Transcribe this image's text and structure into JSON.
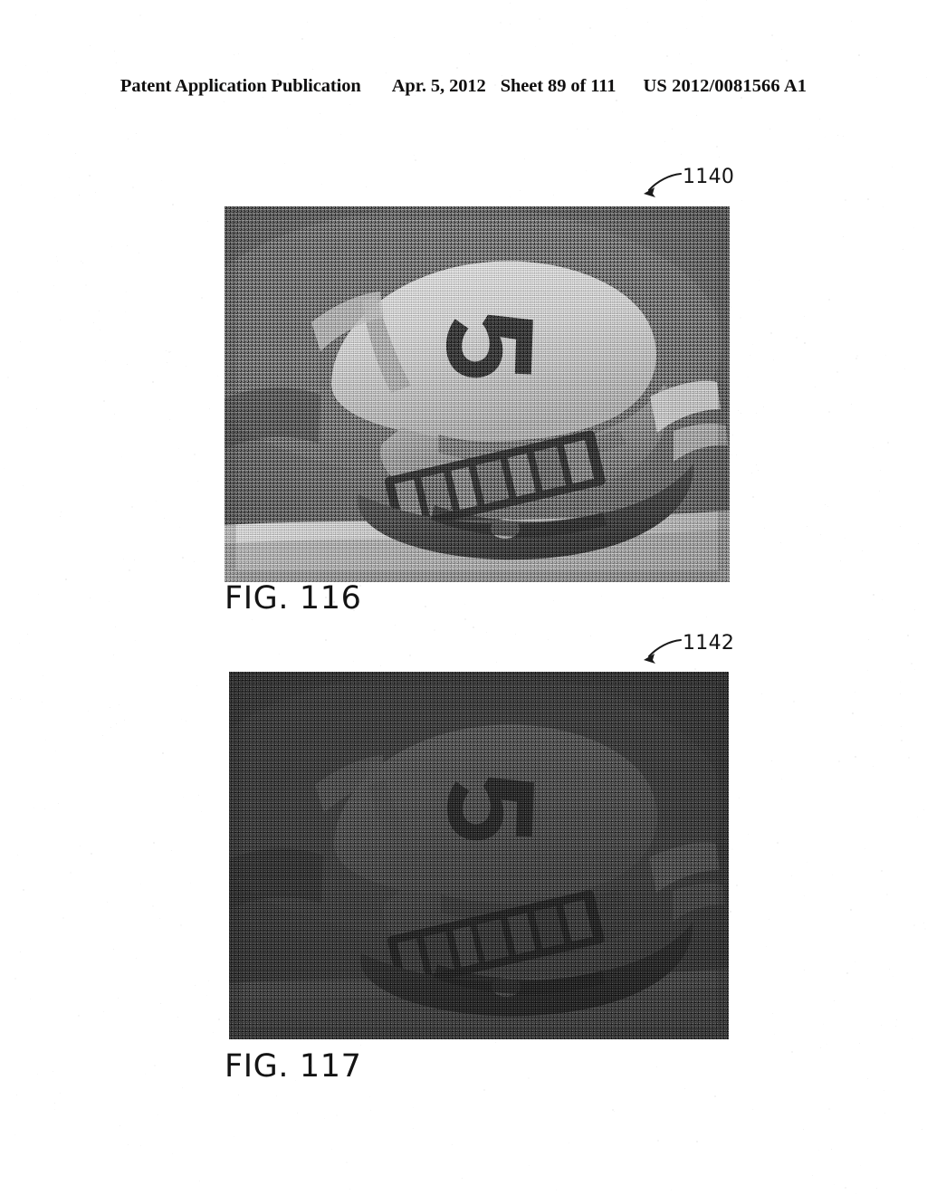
{
  "page": {
    "document_type": "United States Patent Application Publication drawing sheet",
    "background_color": "#ffffff",
    "ink_color": "#141414"
  },
  "header": {
    "publication_label": "Patent Application Publication",
    "publication_date": "Apr. 5, 2012",
    "sheet_label": "Sheet 89 of 111",
    "publication_number": "US 2012/0081566 A1"
  },
  "figures": [
    {
      "id": "fig-116",
      "caption": "FIG. 116",
      "reference_numeral": "1140",
      "description": "Halftone grayscale photograph of a crumpled foil/paper wrapper resting on a surface, with embossed printed characters visible; normal exposure.",
      "exposure": "normal"
    },
    {
      "id": "fig-117",
      "caption": "FIG. 117",
      "reference_numeral": "1142",
      "description": "Halftone grayscale photograph of the same crumpled wrapper subject, captured under reduced illumination so the frame is uniformly dark and low contrast.",
      "exposure": "under-exposed"
    }
  ],
  "callouts": [
    {
      "numeral": "1140",
      "arrow": "curved-arrow-down-left",
      "target_figure": "fig-116"
    },
    {
      "numeral": "1142",
      "arrow": "curved-arrow-down-left",
      "target_figure": "fig-117"
    }
  ],
  "icons": {
    "lead_arrow": "curved-leader-arrow-icon"
  }
}
